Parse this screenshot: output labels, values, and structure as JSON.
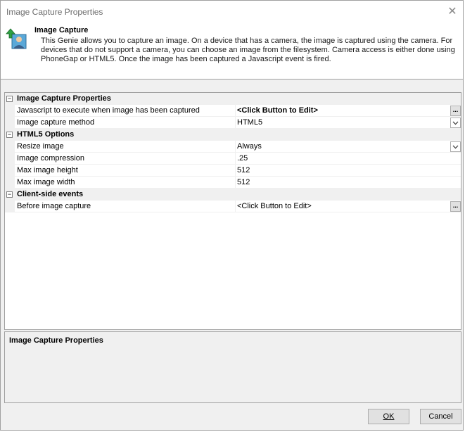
{
  "window": {
    "title": "Image Capture Properties"
  },
  "header": {
    "title": "Image Capture",
    "description": "This Genie allows you to capture an image. On a device that has a camera, the image is captured using the camera. For devices that do not support a camera, you can choose an image from the filesystem. Camera access is either done using PhoneGap or HTML5. Once the image has been captured a Javascript event is fired."
  },
  "grid": {
    "categories": [
      {
        "label": "Image Capture Properties",
        "toggle": "−",
        "props": [
          {
            "name": "Javascript to execute when image has been captured",
            "value": "<Click Button to Edit>",
            "editor": "ellipsis"
          },
          {
            "name": "Image capture method",
            "value": "HTML5",
            "editor": "dropdown"
          }
        ]
      },
      {
        "label": "HTML5 Options",
        "toggle": "−",
        "props": [
          {
            "name": "Resize image",
            "value": "Always",
            "editor": "dropdown"
          },
          {
            "name": "Image compression",
            "value": ".25",
            "editor": "none"
          },
          {
            "name": "Max image height",
            "value": "512",
            "editor": "none"
          },
          {
            "name": "Max image width",
            "value": "512",
            "editor": "none"
          }
        ]
      },
      {
        "label": "Client-side events",
        "toggle": "−",
        "props": [
          {
            "name": "Before image capture",
            "value": "<Click Button to Edit>",
            "editor": "ellipsis"
          }
        ]
      }
    ]
  },
  "help": {
    "title": "Image Capture Properties"
  },
  "buttons": {
    "ok_label": "OK",
    "cancel_label": "Cancel",
    "ellipsis": "...",
    "close_glyph": "✕"
  },
  "icons": {
    "header_icon": "user-upload-icon",
    "close": "close-icon",
    "dropdown": "chevron-down-icon"
  }
}
